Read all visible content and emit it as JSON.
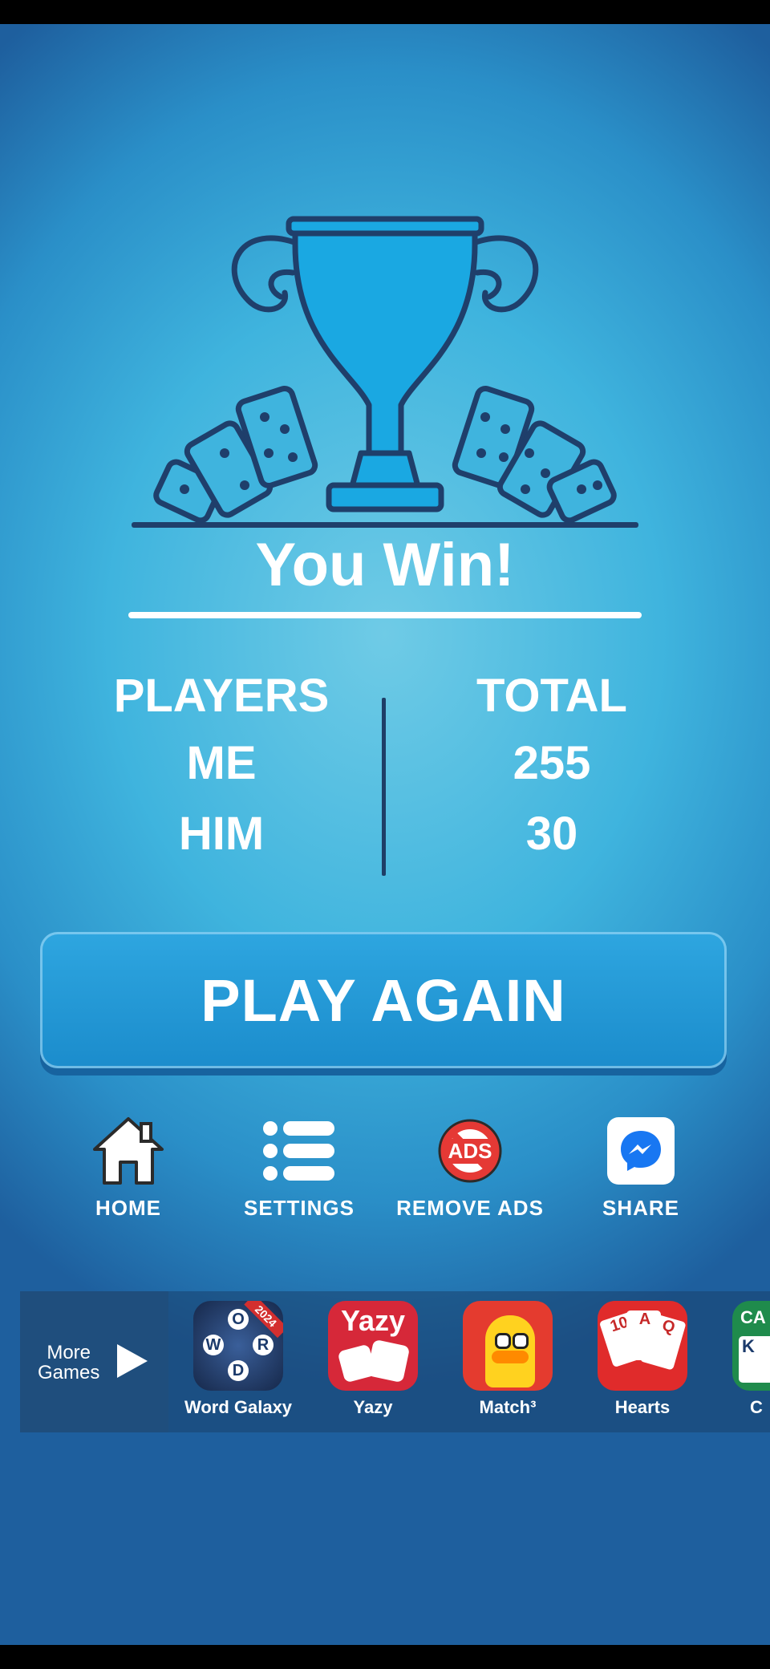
{
  "result": {
    "title": "You Win!"
  },
  "scoreboard": {
    "players_header": "PLAYERS",
    "total_header": "TOTAL",
    "rows": [
      {
        "player": "ME",
        "total": "255"
      },
      {
        "player": "HIM",
        "total": "30"
      }
    ]
  },
  "play_again": {
    "label": "PLAY AGAIN"
  },
  "nav": {
    "home": {
      "label": "HOME",
      "icon": "home-icon"
    },
    "settings": {
      "label": "SETTINGS",
      "icon": "menu-list-icon"
    },
    "remove_ads": {
      "label": "REMOVE ADS",
      "icon": "no-ads-icon",
      "icon_text": "ADS"
    },
    "share": {
      "label": "SHARE",
      "icon": "messenger-icon"
    }
  },
  "more_games": {
    "label_line1": "More",
    "label_line2": "Games",
    "games": [
      {
        "name": "Word Galaxy",
        "badge": "2024",
        "letters": [
          "O",
          "W",
          "R",
          "D"
        ]
      },
      {
        "name": "Yazy",
        "logo": "Yazy"
      },
      {
        "name": "Match³"
      },
      {
        "name": "Hearts",
        "cards": [
          "10",
          "A",
          "Q"
        ]
      },
      {
        "name": "C",
        "logo": "CA",
        "card": "K"
      }
    ]
  },
  "colors": {
    "background_center": "#6fcbe6",
    "background_edge": "#1e5f9e",
    "trophy_fill": "#1aa8e2",
    "trophy_outline": "#1f3f6b",
    "button": "#1b8ccc"
  }
}
